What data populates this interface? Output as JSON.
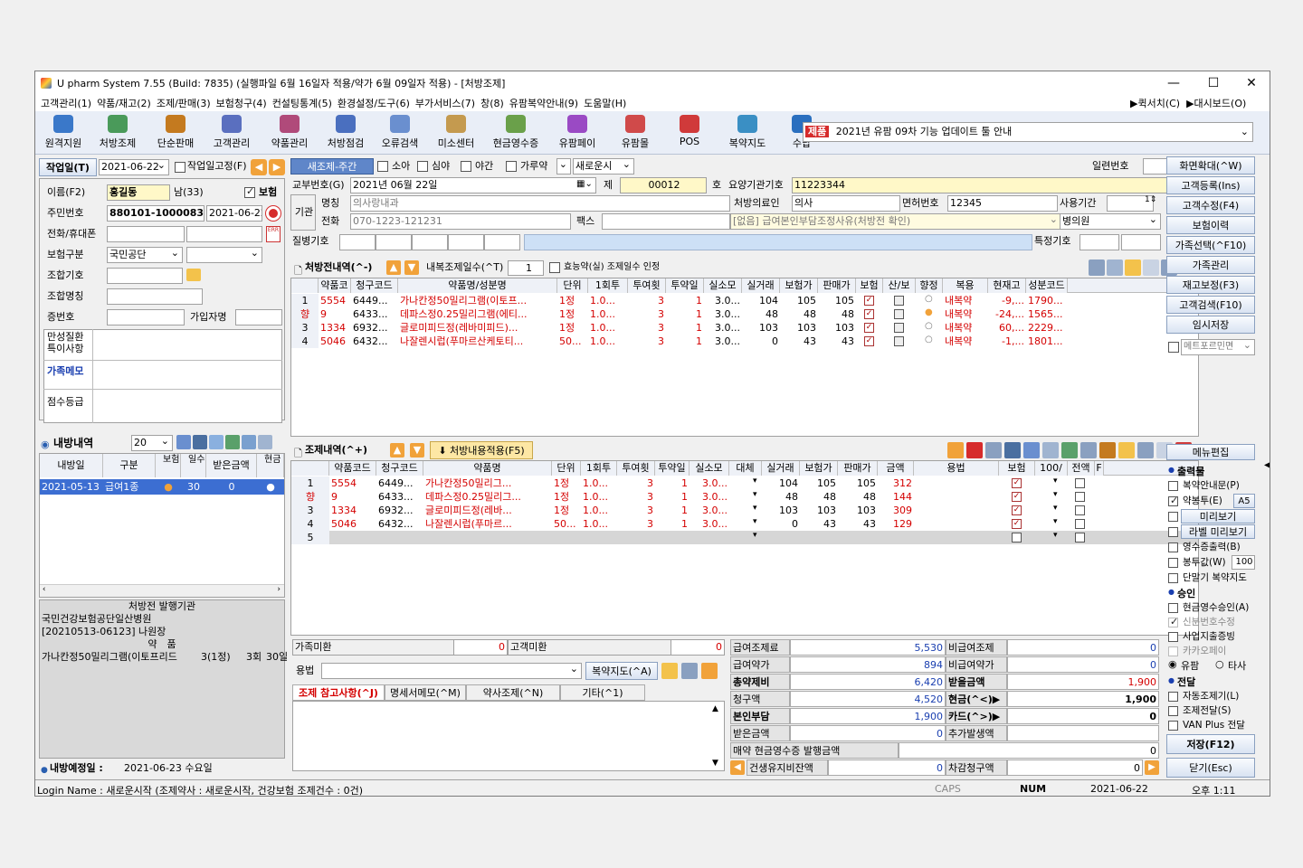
{
  "window": {
    "title": "U pharm System 7.55 (Build: 7835) (실행파일 6월 16일자 적용/약가 6월 09일자 적용) - [처방조제]",
    "min": "—",
    "max": "☐",
    "close": "✕"
  },
  "menu": [
    "고객관리(1)",
    "약품/재고(2)",
    "조제/판매(3)",
    "보험청구(4)",
    "컨설팅통계(5)",
    "환경설정/도구(6)",
    "부가서비스(7)",
    "창(8)",
    "유팜복약안내(9)",
    "도움말(H)"
  ],
  "menu_right": [
    "▶퀵서치(C)",
    "▶대시보드(O)"
  ],
  "toolbar": [
    {
      "label": "원격지원",
      "icon": "remote-support-icon",
      "color": "#3a78c9"
    },
    {
      "label": "처방조제",
      "icon": "prescription-icon",
      "color": "#4a9a5a"
    },
    {
      "label": "단순판매",
      "icon": "simple-sale-icon",
      "color": "#c47a1f"
    },
    {
      "label": "고객관리",
      "icon": "customer-icon",
      "color": "#5a6fbf"
    },
    {
      "label": "약품관리",
      "icon": "drug-manage-icon",
      "color": "#b04a7a"
    },
    {
      "label": "처방점검",
      "icon": "rx-check-icon",
      "color": "#4a6fbf"
    },
    {
      "label": "오류검색",
      "icon": "error-search-icon",
      "color": "#6a8fcf"
    },
    {
      "label": "미소센터",
      "icon": "smile-center-icon",
      "color": "#c49a4f"
    },
    {
      "label": "현금영수증",
      "icon": "cash-receipt-icon",
      "color": "#6aa04a"
    },
    {
      "label": "유팜페이",
      "icon": "upharm-pay-icon",
      "color": "#9a4ac4"
    },
    {
      "label": "유팜몰",
      "icon": "upharm-mall-icon",
      "color": "#d04a4a"
    },
    {
      "label": "POS",
      "icon": "pos-icon",
      "color": "#d03a3a"
    },
    {
      "label": "복약지도",
      "icon": "medication-guide-icon",
      "color": "#3a8fc4"
    },
    {
      "label": "수납",
      "icon": "payment-icon",
      "color": "#2a6fbf"
    }
  ],
  "notice": {
    "tag": "제품",
    "text": "2021년 유팜 09차 기능 업데이트 툴 안내"
  },
  "left": {
    "work_date_label": "작업일(T)",
    "work_date": "2021-06-22",
    "fixed_label": "작업일고정(F)",
    "name_label": "이름(F2)",
    "name": "홍길동",
    "age": "남(33)",
    "insurance_label": "보험",
    "rrn_label": "주민번호",
    "rrn": "880101-1000083",
    "rrn_date": "2021-06-22",
    "phone_label": "전화/휴대폰",
    "ins_type_label": "보험구분",
    "ins_type": "국민공단",
    "assoc_code_label": "조합기호",
    "assoc_name_label": "조합명칭",
    "cert_label": "증번호",
    "member_label": "가입자명",
    "chronic_label": "만성질환 특이사항",
    "family_memo_label": "가족메모",
    "score_label": "점수등급",
    "history_title": "내방내역",
    "history_count": "20",
    "history_headers": [
      "내방일",
      "구분",
      "보험",
      "일수",
      "받은금액",
      "현금"
    ],
    "history_rows": [
      {
        "date": "2021-05-13 ...",
        "type": "급여1종",
        "ins": "●",
        "days": "30",
        "amount": "0",
        "cash": "●"
      }
    ],
    "issuer_title": "처방전 발행기관",
    "issuer": "국민건강보험공단일산병원",
    "issuer_doc": "[20210513-06123] 나원장",
    "drug_title": "약　품",
    "drug_row": {
      "name": "가나칸정50밀리그램(이토프리드",
      "qty": "3(1정)",
      "times": "3회",
      "days": "30일"
    },
    "next_visit_label": "내방예정일 :",
    "next_visit": "2021-06-23 수요일"
  },
  "center": {
    "tab_label": "새조제-주간",
    "opts": [
      "소아",
      "심야",
      "야간",
      "가루약"
    ],
    "new_start": "새로운시",
    "serial_label": "일련번호",
    "issue_label": "교부번호(G)",
    "issue_date": "2021년 06월 22일",
    "je": "제",
    "number": "00012",
    "ho": "호",
    "org_code_label": "요양기관기호",
    "org_code": "11223344",
    "org_label": "기관",
    "org_name_label": "명칭",
    "org_name": "의사랑내과",
    "org_phone_label": "전화",
    "org_phone": "070-1223-121231",
    "fax_label": "팩스",
    "doctor_label": "처방의료인",
    "doctor": "의사",
    "license_label": "면허번호",
    "license": "12345",
    "period_label": "사용기간",
    "reason": "[없음] 급여본인부담조정사유(처방전 확인)",
    "hospital": "병의원",
    "disease_label": "질병기호",
    "special_label": "특정기호",
    "rx_title": "처방전내역(^-)",
    "internal_days_label": "내복조제일수(^T)",
    "internal_days": "1",
    "efficacy_label": "효능약(실) 조제일수 인정",
    "rx_headers": [
      "",
      "약품코",
      "청구코드",
      "약품명/성분명",
      "단위",
      "1회투",
      "투여횟",
      "투약일",
      "실소모",
      "실거래",
      "보험가",
      "판매가",
      "보험",
      "산/보",
      "향정",
      "복용",
      "현재고",
      "성분코드"
    ],
    "rx_rows": [
      {
        "no": "1",
        "code": "5554",
        "claim": "6449...",
        "name": "가나칸정50밀리그램(이토프...",
        "unit": "1정",
        "dose": "1.0...",
        "freq": "3",
        "days": "1",
        "use": "3.0...",
        "real": "104",
        "ins": "105",
        "sell": "105",
        "take": "내복약",
        "stock": "-9,...",
        "ing": "1790..."
      },
      {
        "no": "향",
        "code": "9",
        "claim": "6433...",
        "name": "데파스정0.25밀리그램(에티...",
        "unit": "1정",
        "dose": "1.0...",
        "freq": "3",
        "days": "1",
        "use": "3.0...",
        "real": "48",
        "ins": "48",
        "sell": "48",
        "take": "내복약",
        "stock": "-24,...",
        "ing": "1565..."
      },
      {
        "no": "3",
        "code": "1334",
        "claim": "6932...",
        "name": "글로미피드정(레바미피드)...",
        "unit": "1정",
        "dose": "1.0...",
        "freq": "3",
        "days": "1",
        "use": "3.0...",
        "real": "103",
        "ins": "103",
        "sell": "103",
        "take": "내복약",
        "stock": "60,...",
        "ing": "2229..."
      },
      {
        "no": "4",
        "code": "5046",
        "claim": "6432...",
        "name": "나잘렌시럽(푸마르산케토티...",
        "unit": "50...",
        "dose": "1.0...",
        "freq": "3",
        "days": "1",
        "use": "3.0...",
        "real": "0",
        "ins": "43",
        "sell": "43",
        "take": "내복약",
        "stock": "-1,...",
        "ing": "1801..."
      }
    ],
    "dispense_title": "조제내역(^+)",
    "apply_btn": "처방내용적용(F5)",
    "disp_headers": [
      "",
      "약품코드",
      "청구코드",
      "약품명",
      "단위",
      "1회투",
      "투여횟",
      "투약일",
      "실소모",
      "대체",
      "실거래",
      "보험가",
      "판매가",
      "금액",
      "용법",
      "보험",
      "100/",
      "전액",
      "F"
    ],
    "disp_rows": [
      {
        "no": "1",
        "code": "5554",
        "claim": "6449...",
        "name": "가나칸정50밀리그...",
        "unit": "1정",
        "dose": "1.0...",
        "freq": "3",
        "days": "1",
        "use": "3.0...",
        "real": "104",
        "ins": "105",
        "sell": "105",
        "amt": "312"
      },
      {
        "no": "향",
        "code": "9",
        "claim": "6433...",
        "name": "데파스정0.25밀리그...",
        "unit": "1정",
        "dose": "1.0...",
        "freq": "3",
        "days": "1",
        "use": "3.0...",
        "real": "48",
        "ins": "48",
        "sell": "48",
        "amt": "144"
      },
      {
        "no": "3",
        "code": "1334",
        "claim": "6932...",
        "name": "글로미피드정(레바...",
        "unit": "1정",
        "dose": "1.0...",
        "freq": "3",
        "days": "1",
        "use": "3.0...",
        "real": "103",
        "ins": "103",
        "sell": "103",
        "amt": "309"
      },
      {
        "no": "4",
        "code": "5046",
        "claim": "6432...",
        "name": "나잘렌시럽(푸마르...",
        "unit": "50...",
        "dose": "1.0...",
        "freq": "3",
        "days": "1",
        "use": "3.0...",
        "real": "0",
        "ins": "43",
        "sell": "43",
        "amt": "129"
      },
      {
        "no": "5",
        "code": "",
        "claim": "",
        "name": "",
        "unit": "",
        "dose": "",
        "freq": "",
        "days": "",
        "use": "",
        "real": "",
        "ins": "",
        "sell": "",
        "amt": ""
      }
    ],
    "family_unpaid_label": "가족미환",
    "family_unpaid": "0",
    "customer_unpaid_label": "고객미환",
    "customer_unpaid": "0",
    "usage_label": "용법",
    "guide_btn": "복약지도(^A)",
    "ref_tabs": [
      "조제 참고사항(^J)",
      "명세서메모(^M)",
      "약사조제(^N)",
      "기타(^1)"
    ]
  },
  "billing": {
    "rows": [
      [
        "급여조제료",
        "5,530",
        "비급여조제",
        "0"
      ],
      [
        "급여약가",
        "894",
        "비급여약가",
        "0"
      ],
      [
        "총약제비",
        "6,420",
        "받을금액",
        "1,900"
      ],
      [
        "청구액",
        "4,520",
        "현금(^<)▶",
        "1,900"
      ],
      [
        "본인부담",
        "1,900",
        "카드(^>)▶",
        "0"
      ],
      [
        "받은금액",
        "0",
        "추가발생액",
        ""
      ]
    ],
    "cash_receipt_label": "매약 현금영수증 발행금액",
    "cash_receipt": "0",
    "health_label": "건생유지비잔액",
    "health": "0",
    "remain_label": "차감청구액",
    "remain": "0"
  },
  "right": {
    "buttons": [
      "화면확대(^W)",
      "고객등록(Ins)",
      "고객수정(F4)",
      "보험이력",
      "가족선택(^F10)",
      "가족관리",
      "재고보정(F3)",
      "고객검색(F10)",
      "임시저장"
    ],
    "metformin": "메트포르민면",
    "menu_edit": "메뉴편집",
    "print_title": "출력물",
    "print_opts": [
      "복약안내문(P)",
      "약봉투(E)",
      "미리보기",
      "라벨 미리보기",
      "영수증출력(B)",
      "봉투값(W)",
      "단말기 복약지도"
    ],
    "a5": "A5",
    "bag_value": "100",
    "approve_title": "승인",
    "approve_opts": [
      "현금영수승인(A)",
      "신분번호수정",
      "사업지출증빙",
      "카카오페이"
    ],
    "radio": [
      "유팜",
      "타사"
    ],
    "deliver_title": "전달",
    "deliver_opts": [
      "자동조제기(L)",
      "조제전달(S)",
      "VAN Plus 전달"
    ],
    "save": "저장(F12)",
    "close": "닫기(Esc)"
  },
  "status": {
    "login": "Login Name : 새로운시작 (조제약사 : 새로운시작, 건강보험 조제건수 : 0건)",
    "caps": "CAPS",
    "num": "NUM",
    "date": "2021-06-22",
    "time": "오후 1:11"
  }
}
